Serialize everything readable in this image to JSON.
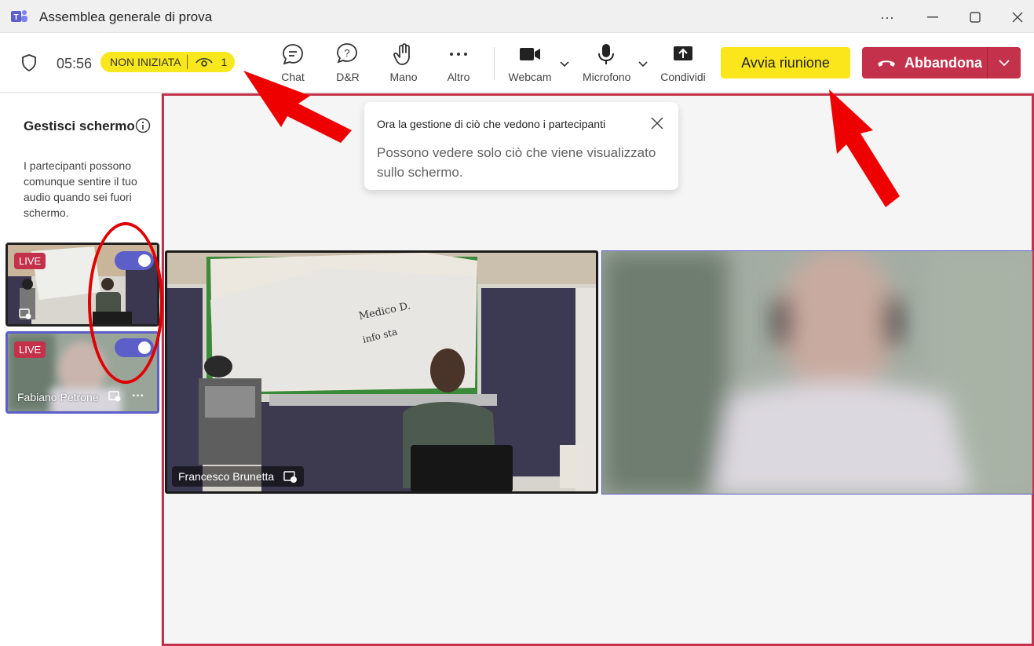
{
  "window": {
    "title": "Assemblea generale di prova",
    "controls": [
      "more",
      "minimize",
      "maximize",
      "close"
    ]
  },
  "toolbar": {
    "timer": "05:56",
    "status": "NON INIZIATA",
    "viewers": "1",
    "items": [
      {
        "label": "Chat",
        "icon": "chat-icon"
      },
      {
        "label": "D&R",
        "icon": "qna-icon"
      },
      {
        "label": "Mano",
        "icon": "hand-icon"
      },
      {
        "label": "Altro",
        "icon": "more-icon"
      },
      {
        "label": "Webcam",
        "icon": "camera-icon"
      },
      {
        "label": "Microfono",
        "icon": "mic-icon"
      },
      {
        "label": "Condividi",
        "icon": "share-icon"
      }
    ],
    "start_label": "Avvia riunione",
    "leave_label": "Abbandona"
  },
  "sidepanel": {
    "title": "Gestisci schermo",
    "description": "I partecipanti possono comunque sentire il tuo audio quando sei fuori schermo.",
    "thumbs": [
      {
        "live": "LIVE",
        "name": "",
        "toggle_on": true
      },
      {
        "live": "LIVE",
        "name": "Fabiano Petrone",
        "toggle_on": true
      }
    ]
  },
  "tip": {
    "title": "Ora la gestione di ciò che vedono i partecipanti",
    "body": "Possono vedere solo ciò che viene visualizzato sullo schermo."
  },
  "stage": {
    "participants": [
      {
        "name": "Francesco Brunetta"
      },
      {
        "name": ""
      }
    ]
  },
  "colors": {
    "accent": "#5b5fc7",
    "leave": "#c4314b",
    "start": "#fae61b",
    "annotation": "#e00000"
  }
}
